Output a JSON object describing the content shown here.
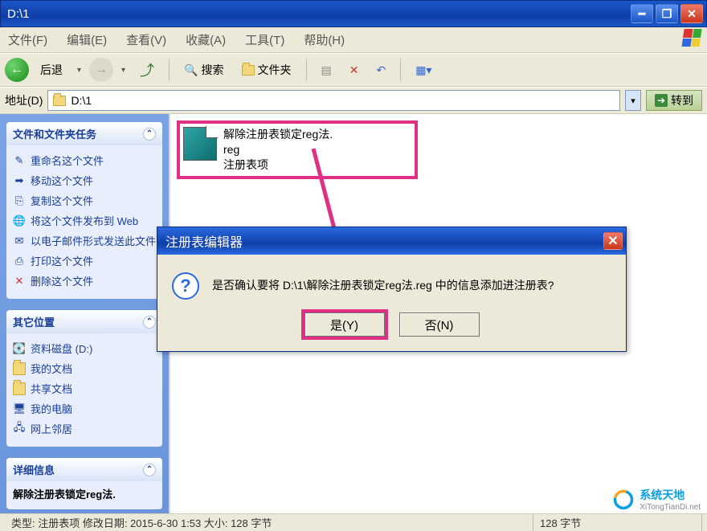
{
  "window": {
    "title": "D:\\1"
  },
  "menu": {
    "file": "文件(F)",
    "edit": "编辑(E)",
    "view": "查看(V)",
    "favorites": "收藏(A)",
    "tools": "工具(T)",
    "help": "帮助(H)"
  },
  "toolbar": {
    "back": "后退",
    "search": "搜索",
    "folders": "文件夹"
  },
  "address": {
    "label": "地址(D)",
    "value": "D:\\1",
    "go": "转到"
  },
  "sidebar": {
    "panel1": {
      "title": "文件和文件夹任务",
      "items": [
        "重命名这个文件",
        "移动这个文件",
        "复制这个文件",
        "将这个文件发布到 Web",
        "以电子邮件形式发送此文件",
        "打印这个文件",
        "删除这个文件"
      ]
    },
    "panel2": {
      "title": "其它位置",
      "items": [
        "资料磁盘 (D:)",
        "我的文档",
        "共享文档",
        "我的电脑",
        "网上邻居"
      ]
    },
    "panel3": {
      "title": "详细信息",
      "line": "解除注册表锁定reg法."
    }
  },
  "file": {
    "line1": "解除注册表锁定reg法.",
    "line2": "reg",
    "line3": "注册表项"
  },
  "dialog": {
    "title": "注册表编辑器",
    "message": "是否确认要将 D:\\1\\解除注册表锁定reg法.reg 中的信息添加进注册表?",
    "yes": "是(Y)",
    "no": "否(N)"
  },
  "status": {
    "left": "类型: 注册表项  修改日期: 2015-6-30 1:53  大小: 128 字节",
    "right": "128 字节"
  },
  "watermark": {
    "name": "系统天地",
    "url": "XiTongTianDi.net"
  }
}
